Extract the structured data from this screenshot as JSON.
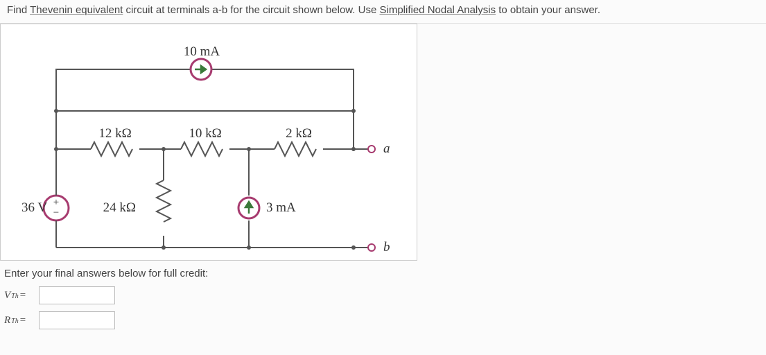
{
  "prompt": {
    "t1": "Find ",
    "thevenin": "Thevenin equivalent",
    "t2": " circuit at terminals a-b for the circuit shown below.  Use ",
    "nodal": "Simplified Nodal Analysis",
    "t3": " to obtain your answer."
  },
  "circuit": {
    "i_top": "10 mA",
    "r12": "12 kΩ",
    "r10": "10 kΩ",
    "r2": "2 kΩ",
    "r24": "24 kΩ",
    "i3": "3 mA",
    "vsrc": "36 V",
    "a": "a",
    "b": "b",
    "plus": "+",
    "minus": "−"
  },
  "answers": {
    "instr": "Enter your final answers below for full credit:",
    "vth_sym": "V",
    "vth_sub": "Th",
    "rth_sym": "R",
    "rth_sub": "Th",
    "eq": " ="
  }
}
